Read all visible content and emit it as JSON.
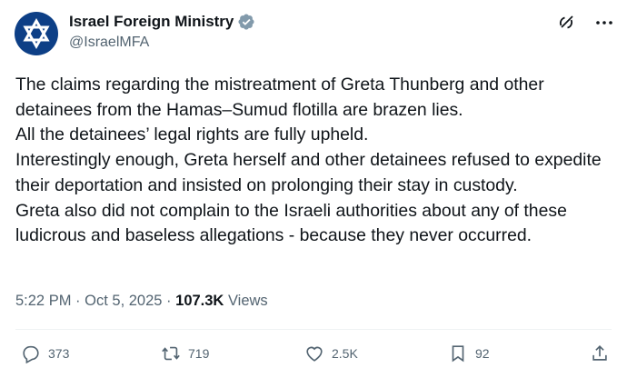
{
  "author": {
    "display_name": "Israel Foreign Ministry",
    "handle": "@IsraelMFA",
    "verified_badge_icon": "verified-badge-icon",
    "avatar_icon": "star-of-david-icon"
  },
  "header_actions": {
    "grok_icon": "grok-icon",
    "more_icon": "more-dots-icon"
  },
  "body": {
    "lines": [
      "The claims regarding the mistreatment of Greta Thunberg and other detainees from the Hamas–Sumud flotilla are brazen lies.",
      "All the detainees’ legal rights are fully upheld.",
      "Interestingly enough, Greta herself and other detainees refused to expedite their deportation and insisted on prolonging their stay in custody.",
      "Greta also did not complain to the Israeli authorities about any of these ludicrous and baseless allegations - because they never occurred."
    ]
  },
  "meta": {
    "time": "5:22 PM",
    "date": "Oct 5, 2025",
    "separator": "·",
    "views_count": "107.3K",
    "views_label": "Views"
  },
  "actions": {
    "replies": {
      "count": "373",
      "icon": "reply-icon"
    },
    "reposts": {
      "count": "719",
      "icon": "repost-icon"
    },
    "likes": {
      "count": "2.5K",
      "icon": "like-icon"
    },
    "bookmarks": {
      "count": "92",
      "icon": "bookmark-icon"
    },
    "share": {
      "icon": "share-icon"
    }
  },
  "colors": {
    "text": "#0f1419",
    "secondary": "#536471",
    "verified_badge": "#829aab",
    "avatar_bg": "#0d3f86"
  }
}
